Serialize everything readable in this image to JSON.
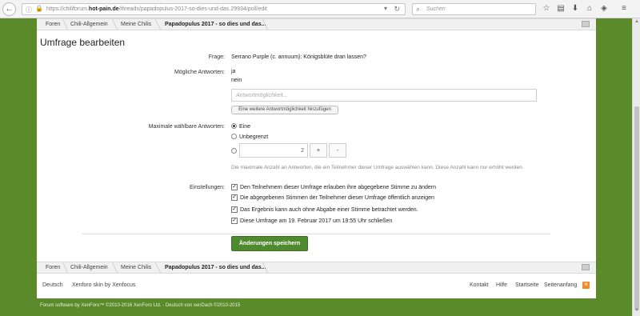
{
  "browser": {
    "url_prefix": "https://chiliforum.",
    "url_domain": "hot-pain.de",
    "url_path": "/threads/papadopulus-2017-so-dies-und-das.29934/poll/edit",
    "search_placeholder": "Suchen",
    "back_icon": "←",
    "forward_icon": "→",
    "reload_icon": "↻",
    "dropdown_icon": "▾",
    "search_icon": "🔍",
    "star_icon": "☆",
    "clipboard_icon": "▤",
    "download_icon": "⬇",
    "home_icon": "⌂",
    "shield_icon": "◈",
    "menu_icon": "≡"
  },
  "breadcrumb": {
    "items": [
      "Foren",
      "Chili-Allgemein",
      "Meine Chilis",
      "Papadopulus 2017 - so dies und das..."
    ]
  },
  "page": {
    "title": "Umfrage bearbeiten"
  },
  "form": {
    "question_label": "Frage:",
    "question_value": "Serrano Purple (c. annuum): Königsblüte dran lassen?",
    "answers_label": "Mögliche Antworten:",
    "answers": [
      "ja",
      "nein"
    ],
    "answer_placeholder": "Antwortmöglichkeit...",
    "add_answer_label": "Eine weitere Antwortmöglichkeit hinzufügen",
    "max_answers_label": "Maximale wählbare Antworten:",
    "max_options": [
      "Eine",
      "Unbegrenzt"
    ],
    "max_custom_value": "2",
    "plus_label": "+",
    "minus_label": "-",
    "max_hint": "Die maximale Anzahl an Antworten, die ein Teilnehmer dieser Umfrage auswählen kann. Diese Anzahl kann nur erhöht werden.",
    "settings_label": "Einstellungen:",
    "settings": [
      "Den Teilnehmern dieser Umfrage erlauben ihre abgegebene Stimme zu ändern",
      "Die abgegebenen Stimmen der Teilnehmer dieser Umfrage öffentlich anzeigen",
      "Das Ergebnis kann auch ohne Abgabe einer Stimme betrachtet werden.",
      "Diese Umfrage am 19. Februar 2017 um 19:55 Uhr schließen"
    ],
    "check_mark": "✓",
    "save_label": "Änderungen speichern"
  },
  "footer": {
    "language": "Deutsch",
    "skin": "Xenforo skin by Xenfocus",
    "links": [
      "Kontakt",
      "Hilfe",
      "Startseite",
      "Seitenanfang"
    ],
    "rss_icon": "≋",
    "copyright": "Forum software by XenForo™ ©2010-2016 XenForo Ltd. - Deutsch von xenDach ©2010-2015"
  },
  "colors": {
    "page_background": "#5b8a2a",
    "save_button": "#4f8a2e"
  }
}
